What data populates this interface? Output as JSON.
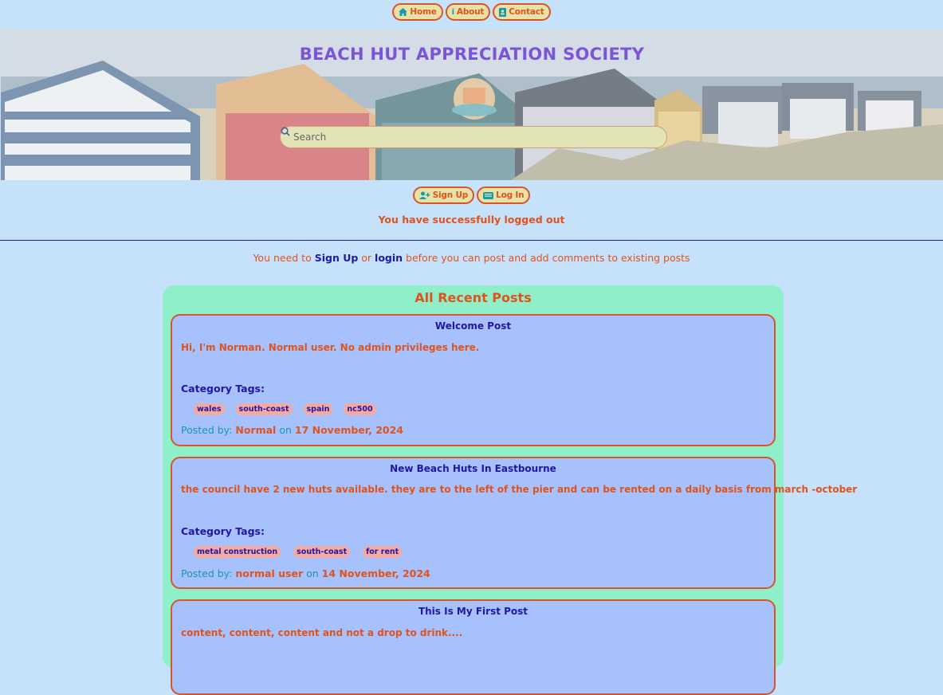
{
  "nav": [
    {
      "label": "Home",
      "icon": "home-icon"
    },
    {
      "label": "About",
      "icon": "info-icon"
    },
    {
      "label": "Contact",
      "icon": "contact-book-icon"
    }
  ],
  "hero": {
    "title": "BEACH HUT APPRECIATION SOCIETY",
    "search_placeholder": "Search"
  },
  "auth": {
    "signup_label": "Sign Up",
    "login_label": "Log In"
  },
  "status_message": "You have successfully logged out",
  "notice": {
    "prefix": "You need to ",
    "signup_link": "Sign Up",
    "middle": " or ",
    "login_link": "login",
    "suffix": " before you can post and add comments to existing posts"
  },
  "posts_section": {
    "title": "All Recent Posts",
    "tags_label": "Category Tags:",
    "posted_by_label": "Posted by:",
    "on_label": "on",
    "posts": [
      {
        "title": "Welcome Post",
        "body": "Hi, I'm Norman. Normal user. No admin privileges here.",
        "tags": [
          "wales",
          "south-coast",
          "spain",
          "nc500"
        ],
        "author": "Normal",
        "date": "17 November, 2024"
      },
      {
        "title": "New Beach Huts In Eastbourne",
        "body": "the council have 2 new huts available. they are to the left of the pier and can be rented on a daily basis from march -october",
        "tags": [
          "metal construction",
          "south-coast",
          "for rent"
        ],
        "author": "normal user",
        "date": "14 November, 2024"
      },
      {
        "title": "This Is My First Post",
        "body": "content, content, content and not a drop to drink....",
        "tags": [],
        "author": "",
        "date": ""
      }
    ]
  },
  "colors": {
    "page_bg": "#c6e2fb",
    "accent_orange": "#e0531c",
    "heading_blue": "#2316a5",
    "panel_green": "#8eefc8",
    "post_blue": "#a6c1fb",
    "title_purple": "#7b55d6"
  }
}
